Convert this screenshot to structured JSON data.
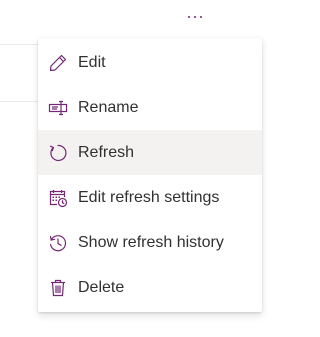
{
  "header": {
    "more_options_label": "..."
  },
  "context_menu": {
    "items": [
      {
        "label": "Edit",
        "icon": "pencil-icon",
        "hovered": false
      },
      {
        "label": "Rename",
        "icon": "rename-icon",
        "hovered": false
      },
      {
        "label": "Refresh",
        "icon": "refresh-icon",
        "hovered": true
      },
      {
        "label": "Edit refresh settings",
        "icon": "calendar-clock-icon",
        "hovered": false
      },
      {
        "label": "Show refresh history",
        "icon": "history-icon",
        "hovered": false
      },
      {
        "label": "Delete",
        "icon": "trash-icon",
        "hovered": false
      }
    ]
  },
  "colors": {
    "icon_accent": "#742774",
    "text": "#323130",
    "hover_background": "#f3f2f1"
  }
}
